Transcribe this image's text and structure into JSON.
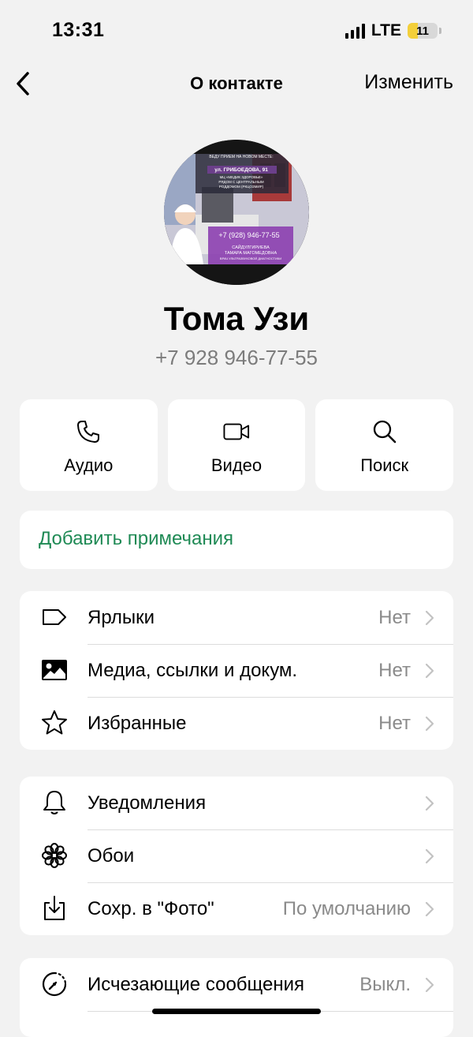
{
  "status": {
    "time": "13:31",
    "network": "LTE",
    "battery": "11"
  },
  "nav": {
    "title": "О контакте",
    "edit_label": "Изменить"
  },
  "avatar": {
    "line1": "ВЕДУ ПРИЕМ НА НОВОМ МЕСТЕ:",
    "address": "ул. ГРИБОЕДОВА, 91",
    "clinic1": "МЦ «МЕДИК ЗДОРОВЬЕ»",
    "clinic2": "РЯДОМ С ЦЕНТРАЛЬНЫМ",
    "clinic3": "РОДДОМОМ (РКЦОЗМИР)",
    "phone": "+7 (928) 946-77-55",
    "name1": "САЙДУЛГИРИЕВА",
    "name2": "ТАМАРА МАГОМЕДОВНА",
    "role": "ВРАЧ УЛЬТРАЗВУКОВОЙ ДИАГНОСТИКИ"
  },
  "contact": {
    "name": "Тома Узи",
    "phone": "+7 928 946-77-55"
  },
  "actions": [
    {
      "label": "Аудио",
      "icon": "phone-icon"
    },
    {
      "label": "Видео",
      "icon": "video-icon"
    },
    {
      "label": "Поиск",
      "icon": "search-icon"
    }
  ],
  "note": {
    "label": "Добавить примечания"
  },
  "group1": [
    {
      "label": "Ярлыки",
      "value": "Нет",
      "icon": "tag-icon"
    },
    {
      "label": "Медиа, ссылки и докум.",
      "value": "Нет",
      "icon": "photo-icon"
    },
    {
      "label": "Избранные",
      "value": "Нет",
      "icon": "star-icon"
    }
  ],
  "group2": [
    {
      "label": "Уведомления",
      "value": "",
      "icon": "bell-icon"
    },
    {
      "label": "Обои",
      "value": "",
      "icon": "flower-icon"
    },
    {
      "label": "Сохр. в \"Фото\"",
      "value": "По умолчанию",
      "icon": "download-icon"
    }
  ],
  "group3": [
    {
      "label": "Исчезающие сообщения",
      "value": "Выкл.",
      "icon": "timer-icon"
    }
  ],
  "colors": {
    "accent": "#1f8a55",
    "background": "#f2f2f2"
  }
}
